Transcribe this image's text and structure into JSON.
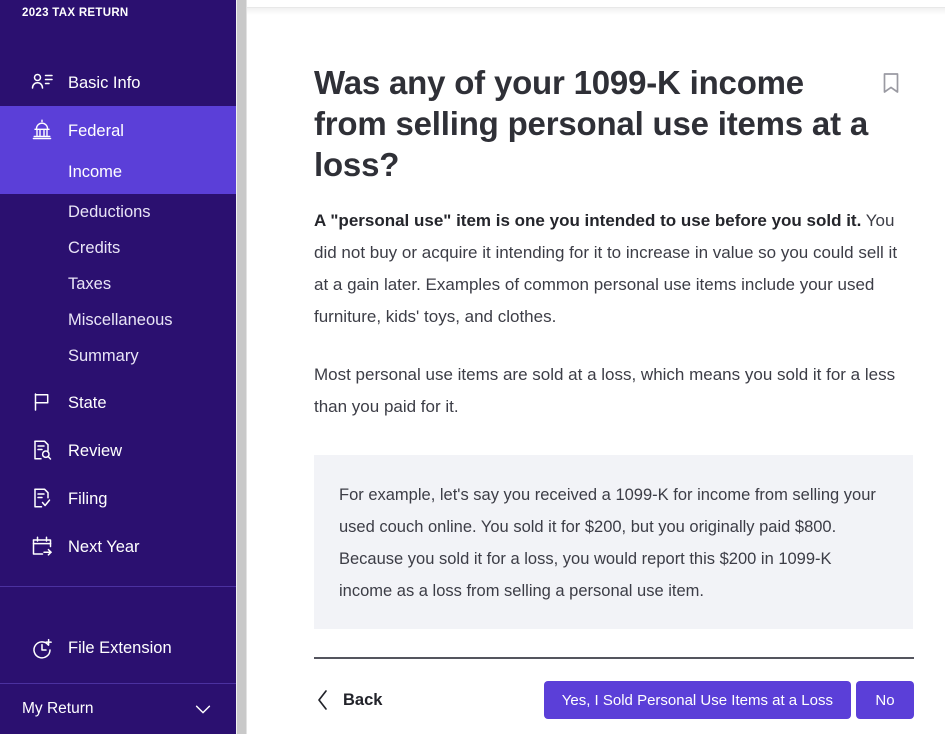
{
  "sidebar": {
    "brand": "2023 TAX RETURN",
    "items": [
      {
        "label": "Basic Info",
        "icon": "contact-card-icon"
      },
      {
        "label": "Federal",
        "icon": "capitol-building-icon",
        "active": true
      },
      {
        "label": "State",
        "icon": "flag-icon"
      },
      {
        "label": "Review",
        "icon": "document-search-icon"
      },
      {
        "label": "Filing",
        "icon": "document-check-icon"
      },
      {
        "label": "Next Year",
        "icon": "calendar-arrow-icon"
      }
    ],
    "federal_subitems": [
      {
        "label": "Income",
        "selected": true
      },
      {
        "label": "Deductions"
      },
      {
        "label": "Credits"
      },
      {
        "label": "Taxes"
      },
      {
        "label": "Miscellaneous"
      },
      {
        "label": "Summary"
      }
    ],
    "file_extension": {
      "label": "File Extension",
      "icon": "clock-plus-icon"
    },
    "my_return": {
      "label": "My Return",
      "icon": "chevron-down-icon"
    },
    "colors": {
      "background": "#2b1070",
      "active": "#5b3fd8",
      "text": "#ffffff",
      "divider": "#4b31a0"
    }
  },
  "main": {
    "title": "Was any of your 1099-K income from selling personal use items at a loss?",
    "bookmark_icon": "bookmark-icon",
    "paragraph1_bold": "A \"personal use\" item is one you intended to use before you sold it.",
    "paragraph1_rest": " You did not buy or acquire it intending for it to increase in value so you could sell it at a gain later. Examples of common personal use items include your used furniture, kids' toys, and clothes.",
    "paragraph2": "Most personal use items are sold at a loss, which means you sold it for a less than you paid for it.",
    "example": "For example, let's say you received a 1099-K for income from selling your used couch online. You sold it for $200, but you originally paid $800. Because you sold it for a loss, you would report this $200 in 1099-K income as a loss from selling a personal use item.",
    "actions": {
      "back_label": "Back",
      "back_icon": "chevron-left-icon",
      "yes_label": "Yes, I Sold Personal Use Items at a Loss",
      "no_label": "No"
    },
    "colors": {
      "primary_button": "#5b3fd8",
      "title_text": "#2f3037",
      "body_text": "#3c3d46",
      "example_background": "#f2f3f7",
      "rule": "#54555e"
    }
  }
}
